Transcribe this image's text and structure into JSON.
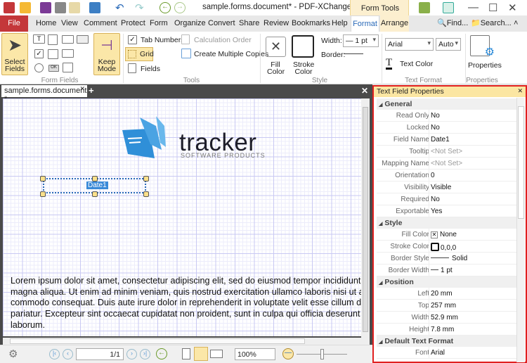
{
  "window": {
    "title": "sample.forms.document* - PDF-XChange Editor",
    "context_tab": "Form Tools"
  },
  "menu": {
    "file": "File",
    "tabs": [
      "Home",
      "View",
      "Comment",
      "Protect",
      "Form",
      "Organize",
      "Convert",
      "Share",
      "Review",
      "Bookmarks",
      "Help",
      "Format",
      "Arrange"
    ],
    "active": "Format",
    "find": "Find...",
    "search": "Search..."
  },
  "ribbon": {
    "select_fields": "Select Fields",
    "keep_mode": "Keep Mode",
    "form_fields_group": "Form Fields",
    "tab_numbers": "Tab Numbers",
    "calculation_order": "Calculation Order",
    "grid": "Grid",
    "create_multiple_copies": "Create Multiple Copies",
    "fields": "Fields",
    "tools_group": "Tools",
    "fill_color": "Fill Color",
    "stroke_color": "Stroke Color",
    "width_label": "Width:",
    "width_value": "— 1 pt",
    "border_label": "Border:",
    "style_group": "Style",
    "font": "Arial",
    "font_size": "Auto",
    "text_color": "Text Color",
    "text_format_group": "Text Format",
    "properties": "Properties",
    "properties_group": "Properties"
  },
  "document": {
    "tab": "sample.forms.document *",
    "logo_word": "tracker",
    "logo_sub": "SOFTWARE PRODUCTS",
    "field_label": "Date1",
    "lorem": [
      "Lorem ipsum dolor sit amet, consectetur adipiscing elit, sed do eiusmod tempor incididunt ut labore et dolore",
      "magna aliqua. Ut enim ad minim veniam, quis nostrud exercitation ullamco laboris nisi ut aliquip ex ea",
      "commodo consequat. Duis aute irure dolor in reprehenderit in voluptate velit esse cillum dolore eu fugiat nulla",
      "pariatur. Excepteur sint occaecat cupidatat non proident, sunt in culpa qui officia deserunt mollit anim id est",
      "laborum."
    ]
  },
  "statusbar": {
    "page": "1/1",
    "zoom": "100%",
    "zoom_slider": 0.5
  },
  "panel": {
    "title": "Text Field Properties",
    "sections": [
      {
        "name": "General",
        "rows": [
          [
            "Read Only",
            "No"
          ],
          [
            "Locked",
            "No"
          ],
          [
            "Field Name",
            "Date1"
          ],
          [
            "Tooltip",
            "<Not Set>"
          ],
          [
            "Mapping Name",
            "<Not Set>"
          ],
          [
            "Orientation",
            "0"
          ],
          [
            "Visibility",
            "Visible"
          ],
          [
            "Required",
            "No"
          ],
          [
            "Exportable",
            "Yes"
          ]
        ]
      },
      {
        "name": "Style",
        "rows": [
          [
            "Fill Color",
            "None"
          ],
          [
            "Stroke Color",
            "0,0,0"
          ],
          [
            "Border Style",
            "Solid"
          ],
          [
            "Border Width",
            "1 pt"
          ]
        ]
      },
      {
        "name": "Position",
        "rows": [
          [
            "Left",
            "20 mm"
          ],
          [
            "Top",
            "257 mm"
          ],
          [
            "Width",
            "52.9 mm"
          ],
          [
            "Height",
            "7.8 mm"
          ]
        ]
      },
      {
        "name": "Default Text Format",
        "rows": [
          [
            "Font",
            "Arial"
          ]
        ]
      }
    ]
  },
  "colors": {
    "accent": "#2a6ab8",
    "file_tab": "#c4373a",
    "highlight": "#fbe7a8",
    "panel_border": "#e02020"
  }
}
